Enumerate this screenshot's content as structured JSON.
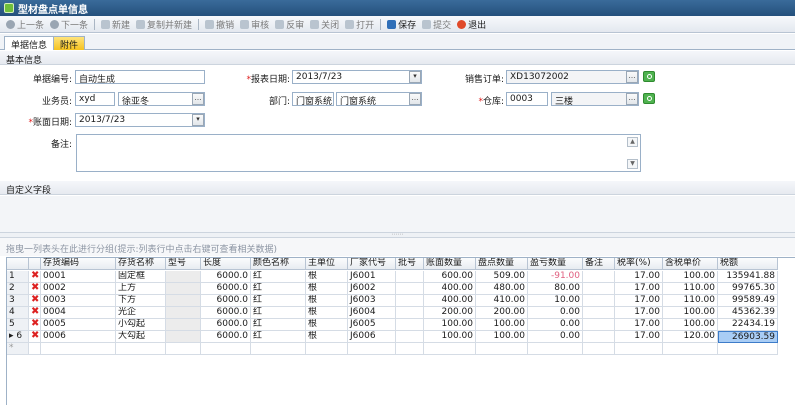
{
  "window": {
    "title": "型材盘点单信息"
  },
  "toolbar": {
    "items": [
      {
        "label": "上一条",
        "icon": "arrow-left-icon",
        "enabled": false
      },
      {
        "label": "下一条",
        "icon": "arrow-right-icon",
        "enabled": false
      },
      {
        "label": "新建",
        "icon": "plus-icon",
        "enabled": false
      },
      {
        "label": "复制并新建",
        "icon": "copy-icon",
        "enabled": false
      },
      {
        "label": "撤销",
        "icon": "undo-icon",
        "enabled": false
      },
      {
        "label": "审核",
        "icon": "check-icon",
        "enabled": false
      },
      {
        "label": "反审",
        "icon": "uncheck-icon",
        "enabled": false
      },
      {
        "label": "关闭",
        "icon": "close-doc-icon",
        "enabled": false
      },
      {
        "label": "打开",
        "icon": "open-doc-icon",
        "enabled": false
      },
      {
        "label": "保存",
        "icon": "save-icon",
        "enabled": true
      },
      {
        "label": "提交",
        "icon": "submit-icon",
        "enabled": false
      },
      {
        "label": "退出",
        "icon": "exit-icon",
        "enabled": true
      }
    ]
  },
  "tabs": [
    {
      "label": "单据信息"
    },
    {
      "label": "附件"
    }
  ],
  "basic_info": {
    "section_title": "基本信息",
    "doc_no_label": "单据编号:",
    "doc_no_value": "自动生成",
    "report_date_label": "报表日期:",
    "report_date_value": "2013/7/23",
    "sales_order_label": "销售订单:",
    "sales_order_value": "XD13072002",
    "salesperson_label": "业务员:",
    "salesperson_code": "xyd",
    "salesperson_name": "徐亚冬",
    "dept_label": "部门:",
    "dept_code": "门窗系统",
    "dept_name": "门窗系统",
    "warehouse_label": "仓库:",
    "warehouse_code": "0003",
    "warehouse_name": "三楼",
    "account_date_label": "账面日期:",
    "account_date_value": "2013/7/23",
    "remark_label": "备注:",
    "remark_value": ""
  },
  "custom_fields": {
    "section_title": "自定义字段"
  },
  "grid": {
    "group_hint": "拖曳一列表头在此进行分组(提示:列表行中点击右键可查看相关数据)",
    "columns": [
      "",
      "",
      "存货编码",
      "存货名称",
      "型号",
      "长度",
      "颜色名称",
      "主单位",
      "厂家代号",
      "批号",
      "账面数量",
      "盘点数量",
      "盈亏数量",
      "备注",
      "税率(%)",
      "含税单价",
      "税额"
    ],
    "rows": [
      {
        "idx": "1",
        "code": "0001",
        "name": "固定框",
        "model": "",
        "length": "6000.0",
        "color": "红",
        "unit": "根",
        "maker": "J6001",
        "batch": "",
        "book_qty": "600.00",
        "count_qty": "509.00",
        "diff_qty": "-91.00",
        "remark": "",
        "tax_rate": "17.00",
        "price": "100.00",
        "tax": "135941.88"
      },
      {
        "idx": "2",
        "code": "0002",
        "name": "上方",
        "model": "",
        "length": "6000.0",
        "color": "红",
        "unit": "根",
        "maker": "J6002",
        "batch": "",
        "book_qty": "400.00",
        "count_qty": "480.00",
        "diff_qty": "80.00",
        "remark": "",
        "tax_rate": "17.00",
        "price": "110.00",
        "tax": "99765.30"
      },
      {
        "idx": "3",
        "code": "0003",
        "name": "下方",
        "model": "",
        "length": "6000.0",
        "color": "红",
        "unit": "根",
        "maker": "J6003",
        "batch": "",
        "book_qty": "400.00",
        "count_qty": "410.00",
        "diff_qty": "10.00",
        "remark": "",
        "tax_rate": "17.00",
        "price": "110.00",
        "tax": "99589.49"
      },
      {
        "idx": "4",
        "code": "0004",
        "name": "光企",
        "model": "",
        "length": "6000.0",
        "color": "红",
        "unit": "根",
        "maker": "J6004",
        "batch": "",
        "book_qty": "200.00",
        "count_qty": "200.00",
        "diff_qty": "0.00",
        "remark": "",
        "tax_rate": "17.00",
        "price": "100.00",
        "tax": "45362.39"
      },
      {
        "idx": "5",
        "code": "0005",
        "name": "小勾起",
        "model": "",
        "length": "6000.0",
        "color": "红",
        "unit": "根",
        "maker": "J6005",
        "batch": "",
        "book_qty": "100.00",
        "count_qty": "100.00",
        "diff_qty": "0.00",
        "remark": "",
        "tax_rate": "17.00",
        "price": "100.00",
        "tax": "22434.19"
      },
      {
        "idx": "6",
        "code": "0006",
        "name": "大勾起",
        "model": "",
        "length": "6000.0",
        "color": "红",
        "unit": "根",
        "maker": "J6006",
        "batch": "",
        "book_qty": "100.00",
        "count_qty": "100.00",
        "diff_qty": "0.00",
        "remark": "",
        "tax_rate": "17.00",
        "price": "120.00",
        "tax": "26903.59"
      }
    ],
    "current_row_marker": "▸",
    "new_row_marker": "*"
  },
  "colors": {
    "title_bg": "#24507c",
    "accent_green": "#4fb24f",
    "negative": "#e06080",
    "selected": "#a9cdf5",
    "delete_red": "#dd2222"
  }
}
